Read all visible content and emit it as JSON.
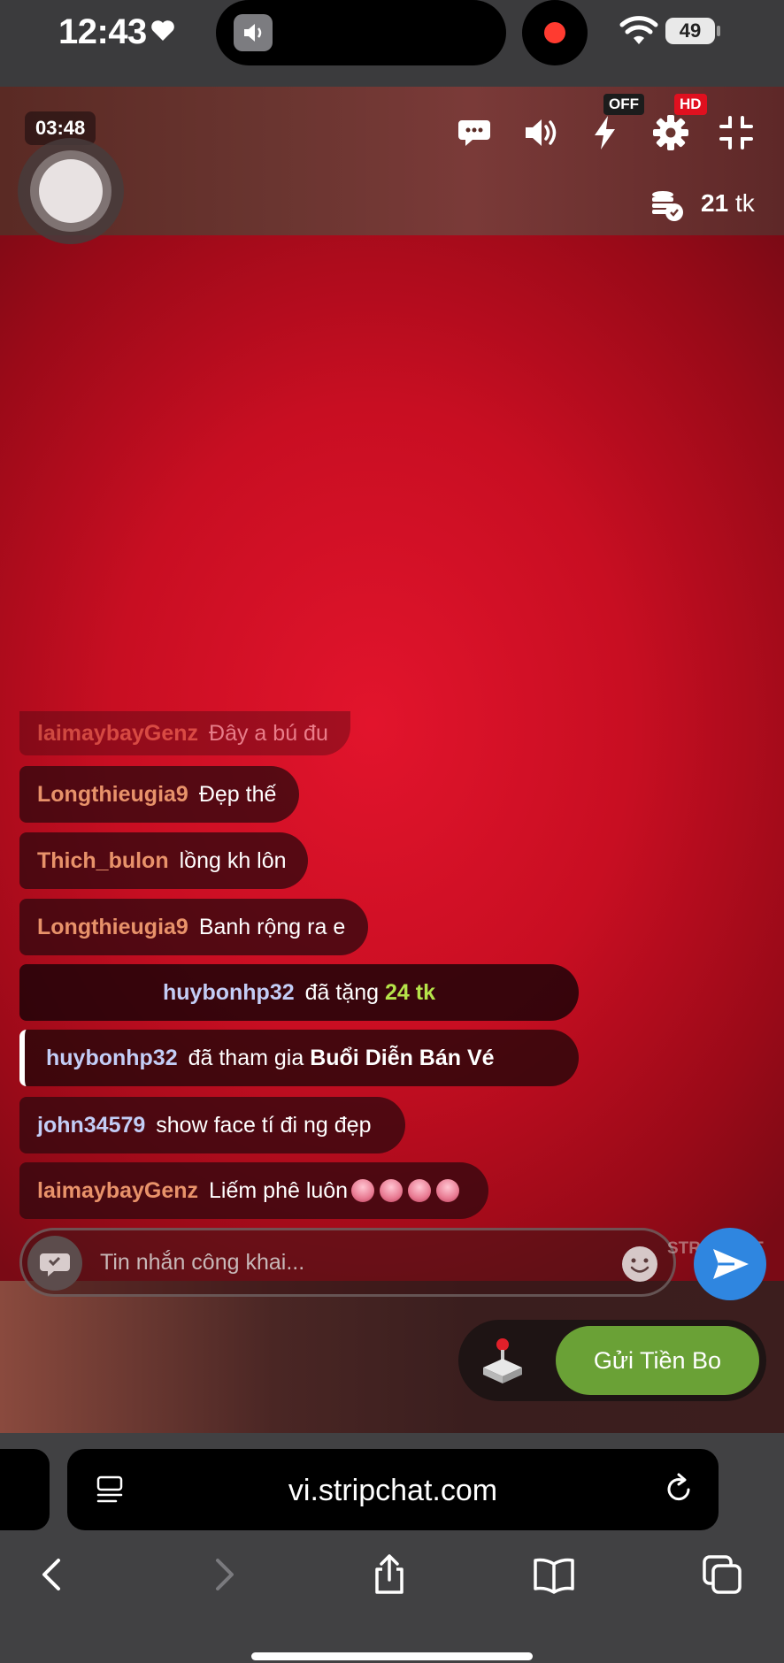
{
  "status_bar": {
    "time": "12:43",
    "battery": "49"
  },
  "stream": {
    "timer": "03:48",
    "quality_off": "OFF",
    "quality_hd": "HD",
    "balance_value": "21",
    "balance_unit": "tk"
  },
  "chat": {
    "m0": {
      "user": "laimaybayGenz",
      "text": "Đây a bú đu"
    },
    "m1": {
      "user": "Longthieugia9",
      "text": "Đẹp thế"
    },
    "m2": {
      "user": "Thich_bulon",
      "text": "lồng kh lôn"
    },
    "m3": {
      "user": "Longthieugia9",
      "text": "Banh rộng ra e"
    },
    "m4": {
      "user": "huybonhp32",
      "text": "đã tặng",
      "amount": "24 tk"
    },
    "m5": {
      "user": "huybonhp32",
      "text": "đã tham gia",
      "event": "Buổi Diễn Bán Vé"
    },
    "m6": {
      "user": "john34579",
      "text": "show face tí đi ng đẹp"
    },
    "m7": {
      "user": "laimaybayGenz",
      "text": "Liếm phê luôn"
    }
  },
  "input": {
    "placeholder": "Tin nhắn công khai...",
    "stream_label": "STREAMLIT"
  },
  "tip_button": "Gửi Tiền Bo",
  "browser": {
    "url": "vi.stripchat.com"
  },
  "colors": {
    "accent_green": "#6aa136",
    "send_blue": "#2f86e0",
    "hd_red": "#e0101f",
    "stream_red": "#e2142c"
  }
}
